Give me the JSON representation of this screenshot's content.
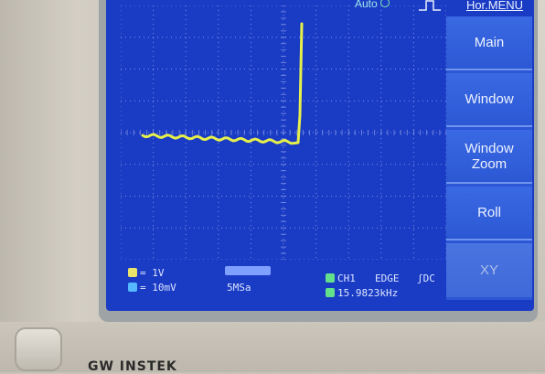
{
  "top_bar": {
    "trigger_mode": "Auto",
    "menu_title": "Hor.MENU"
  },
  "menu": {
    "items": [
      {
        "label": "Main",
        "enabled": true
      },
      {
        "label": "Window",
        "enabled": true
      },
      {
        "label": "Window\nZoom",
        "enabled": true
      },
      {
        "label": "Roll",
        "enabled": true
      },
      {
        "label": "XY",
        "enabled": false
      }
    ]
  },
  "status": {
    "ch1_scale": "= 1V",
    "ch2_scale": "= 10mV",
    "sample_rate": "5MSa",
    "trigger_source": "CH1",
    "trigger_type": "EDGE",
    "trigger_coupling": "ʃDC",
    "frequency": "15.9823kHz"
  },
  "colors": {
    "screen_bg": "#1a3bc4",
    "trace": "#e6f04a",
    "ch1_badge": "#e9e36a",
    "ch2_badge": "#56b8ff",
    "trigger_badge": "#63e08a"
  },
  "brand": "GW INSTEK"
}
